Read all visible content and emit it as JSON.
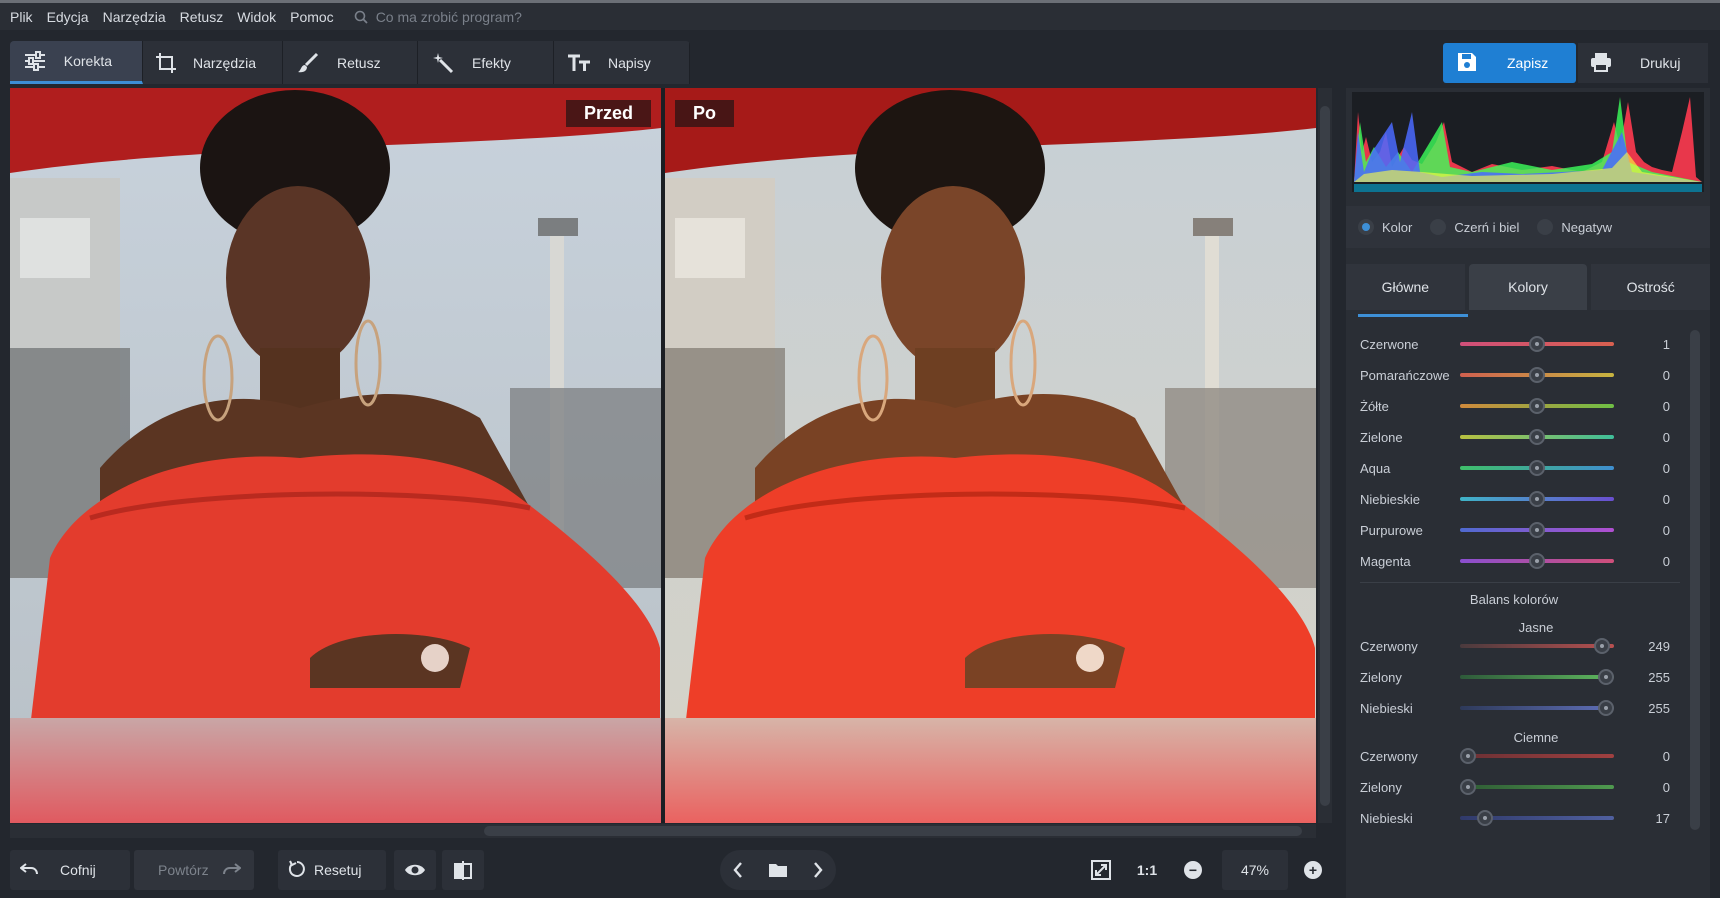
{
  "menu": [
    "Plik",
    "Edycja",
    "Narzędzia",
    "Retusz",
    "Widok",
    "Pomoc"
  ],
  "search": {
    "placeholder": "Co ma zrobić program?"
  },
  "tabs": [
    {
      "label": "Korekta",
      "icon": "sliders-icon"
    },
    {
      "label": "Narzędzia",
      "icon": "crop-icon"
    },
    {
      "label": "Retusz",
      "icon": "brush-icon"
    },
    {
      "label": "Efekty",
      "icon": "magic-wand-icon"
    },
    {
      "label": "Napisy",
      "icon": "text-icon"
    }
  ],
  "actions": {
    "save": "Zapisz",
    "print": "Drukuj"
  },
  "preview": {
    "before": "Przed",
    "after": "Po"
  },
  "bottom": {
    "undo": "Cofnij",
    "redo": "Powtórz",
    "reset": "Resetuj",
    "one_to_one": "1:1",
    "zoom": "47%"
  },
  "modes": [
    {
      "label": "Kolor",
      "selected": true
    },
    {
      "label": "Czerń i biel",
      "selected": false
    },
    {
      "label": "Negatyw",
      "selected": false
    }
  ],
  "panel_tabs": [
    "Główne",
    "Kolory",
    "Ostrość"
  ],
  "hsl": [
    {
      "label": "Czerwone",
      "value": "1",
      "colors": [
        "#d04f7a",
        "#d8604f"
      ]
    },
    {
      "label": "Pomarańczowe",
      "value": "0",
      "colors": [
        "#d0604f",
        "#c7b440"
      ]
    },
    {
      "label": "Żółte",
      "value": "0",
      "colors": [
        "#d08a3c",
        "#6fbf45"
      ]
    },
    {
      "label": "Zielone",
      "value": "0",
      "colors": [
        "#b8c040",
        "#3fbf9a"
      ]
    },
    {
      "label": "Aqua",
      "value": "0",
      "colors": [
        "#3fbf6a",
        "#3f8fd0"
      ]
    },
    {
      "label": "Niebieskie",
      "value": "0",
      "colors": [
        "#3fb4c8",
        "#6a4fd0"
      ]
    },
    {
      "label": "Purpurowe",
      "value": "0",
      "colors": [
        "#4f6ad0",
        "#b04fd0"
      ]
    },
    {
      "label": "Magenta",
      "value": "0",
      "colors": [
        "#8a4fd0",
        "#d04f7a"
      ]
    }
  ],
  "balance": {
    "title": "Balans kolorów",
    "light_title": "Jasne",
    "dark_title": "Ciemne",
    "light": [
      {
        "label": "Czerwony",
        "value": "249",
        "colors": [
          "#4a3a3d",
          "#b85050"
        ]
      },
      {
        "label": "Zielony",
        "value": "255",
        "colors": [
          "#2e5a3a",
          "#5fb85f"
        ]
      },
      {
        "label": "Niebieski",
        "value": "255",
        "colors": [
          "#2e3a5a",
          "#5f6fb8"
        ]
      }
    ],
    "dark": [
      {
        "label": "Czerwony",
        "value": "0",
        "colors": [
          "#6a3034",
          "#a04040"
        ]
      },
      {
        "label": "Zielony",
        "value": "0",
        "colors": [
          "#2e5a34",
          "#4f9a4f"
        ]
      },
      {
        "label": "Niebieski",
        "value": "17",
        "colors": [
          "#303a6a",
          "#5060a0"
        ]
      }
    ]
  },
  "slider_levels": {
    "hsl": [
      0.5,
      0.5,
      0.5,
      0.5,
      0.5,
      0.5,
      0.5,
      0.5
    ],
    "light": [
      0.97,
      1.0,
      1.0
    ],
    "dark": [
      0.0,
      0.0,
      0.12
    ]
  },
  "accent": "#1f7fd3"
}
